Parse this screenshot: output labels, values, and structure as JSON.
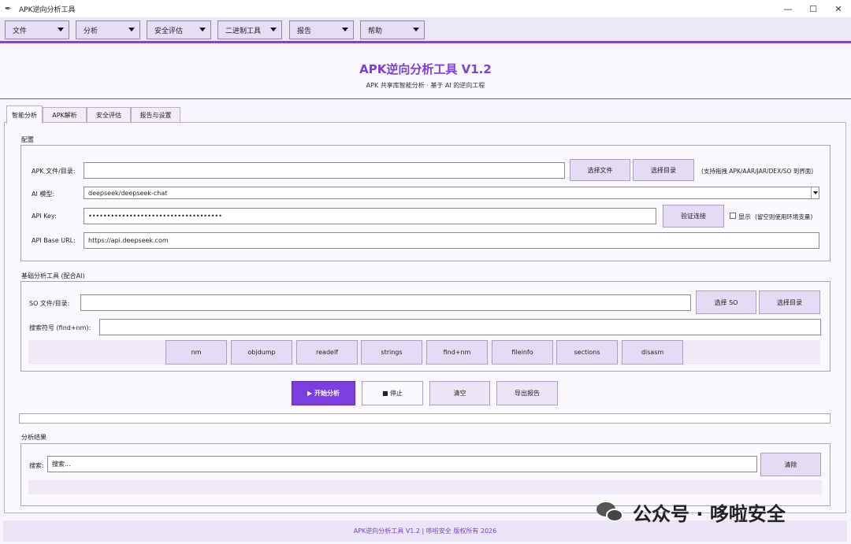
{
  "window": {
    "title": "APK逆向分析工具",
    "minimize": "—",
    "maximize": "☐",
    "close": "✕"
  },
  "menubar": [
    "文件",
    "分析",
    "安全评估",
    "二进制工具",
    "报告",
    "帮助"
  ],
  "header": {
    "title": "APK逆向分析工具 V1.2",
    "subtitle": "APK 共享库智能分析 · 基于 AI 的逆向工程"
  },
  "tabs": [
    "智能分析",
    "APK解析",
    "安全评估",
    "报告与设置"
  ],
  "config": {
    "section_label": "配置",
    "apk_label": "APK 文件/目录:",
    "apk_value": "",
    "select_file": "选择文件",
    "select_dir": "选择目录",
    "drag_hint": "(支持拖拽 APK/AAR/JAR/DEX/SO 到界面)",
    "model_label": "AI 模型:",
    "model_value": "deepseek/deepseek-chat",
    "apikey_label": "API Key:",
    "apikey_value": "••••••••••••••••••••••••••••••••••••",
    "verify_btn": "验证连接",
    "show_label": "显示",
    "env_hint": "(留空则使用环境变量)",
    "baseurl_label": "API Base URL:",
    "baseurl_value": "https://api.deepseek.com"
  },
  "basic_tools": {
    "section_label": "基础分析工具 (配合AI)",
    "so_label": "SO 文件/目录:",
    "so_value": "",
    "select_so": "选择 SO",
    "select_dir": "选择目录",
    "symbol_label": "搜索符号 (find+nm):",
    "symbol_value": "",
    "tools": [
      "nm",
      "objdump",
      "readelf",
      "strings",
      "find+nm",
      "fileinfo",
      "sections",
      "disasm"
    ]
  },
  "actions": {
    "start": "▶ 开始分析",
    "stop": "■ 停止",
    "clear": "清空",
    "export": "导出报告"
  },
  "progress": 0,
  "results": {
    "section_label": "分析结果",
    "search_label": "搜索:",
    "search_placeholder": "搜索...",
    "clear_btn": "清除"
  },
  "footer": "APK逆向分析工具 V1.2 | 哆啦安全 版权所有 2026",
  "watermark": "公众号 · 哆啦安全"
}
